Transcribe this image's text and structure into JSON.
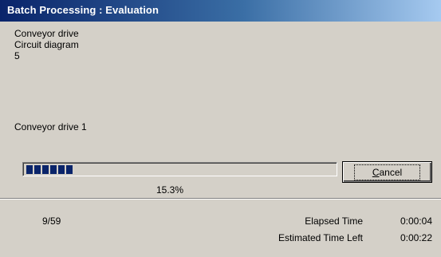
{
  "window": {
    "title": "Batch Processing : Evaluation"
  },
  "info": {
    "project": "Conveyor drive",
    "document_type": "Circuit diagram",
    "count": "5",
    "current_item": "Conveyor drive 1"
  },
  "progress": {
    "fraction": 0.153,
    "percent_label": "15.3%",
    "fill_color": "#0a246a"
  },
  "buttons": {
    "cancel_mnemonic": "C",
    "cancel_rest": "ancel"
  },
  "footer": {
    "counter": "9/59",
    "elapsed_label": "Elapsed Time",
    "elapsed_value": "0:00:04",
    "remaining_label": "Estimated Time Left",
    "remaining_value": "0:00:22"
  },
  "colors": {
    "title_start": "#0a246a",
    "title_end": "#a6caf0",
    "face": "#d4d0c8"
  }
}
